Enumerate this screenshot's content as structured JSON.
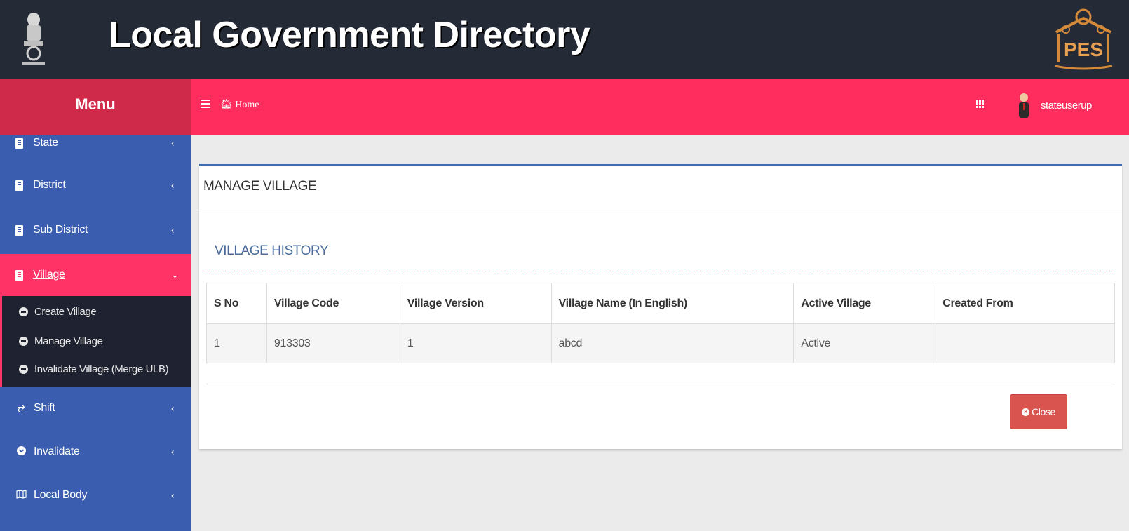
{
  "header": {
    "title": "Local Government Directory",
    "emblem_icon": "national-emblem-icon",
    "logo_text": "PES"
  },
  "sidebar": {
    "menu_title": "Menu",
    "items": [
      {
        "label": "State",
        "icon": "document-icon",
        "chevron": "‹"
      },
      {
        "label": "District",
        "icon": "document-icon",
        "chevron": "‹"
      },
      {
        "label": "Sub District",
        "icon": "document-icon",
        "chevron": "‹"
      },
      {
        "label": "Village",
        "icon": "document-icon",
        "chevron": "⌄",
        "active": true
      },
      {
        "label": "Shift",
        "icon": "swap-arrows-icon",
        "chevron": "‹"
      },
      {
        "label": "Invalidate",
        "icon": "chevron-circle-icon",
        "chevron": "‹"
      },
      {
        "label": "Local Body",
        "icon": "map-icon",
        "chevron": "‹"
      }
    ],
    "submenu": [
      {
        "label": "Create Village"
      },
      {
        "label": "Manage Village"
      },
      {
        "label": "Invalidate Village (Merge ULB)"
      }
    ]
  },
  "navbar": {
    "home_label": "Home",
    "username": "stateuserup"
  },
  "panel": {
    "title": "MANAGE VILLAGE",
    "section_title": "VILLAGE HISTORY",
    "table": {
      "headers": [
        "S No",
        "Village Code",
        "Village Version",
        "Village Name (In English)",
        "Active Village",
        "Created From"
      ],
      "rows": [
        [
          "1",
          "913303",
          "1",
          "abcd",
          "Active",
          ""
        ]
      ]
    },
    "close_label": "Close"
  },
  "colors": {
    "header_bg": "#252a37",
    "sidebar_bg": "#3a5db0",
    "menu_head_bg": "#d02a4a",
    "navbar_bg": "#ff2d5e",
    "active_item_bg": "#ff3366",
    "close_button_bg": "#d9534f"
  }
}
